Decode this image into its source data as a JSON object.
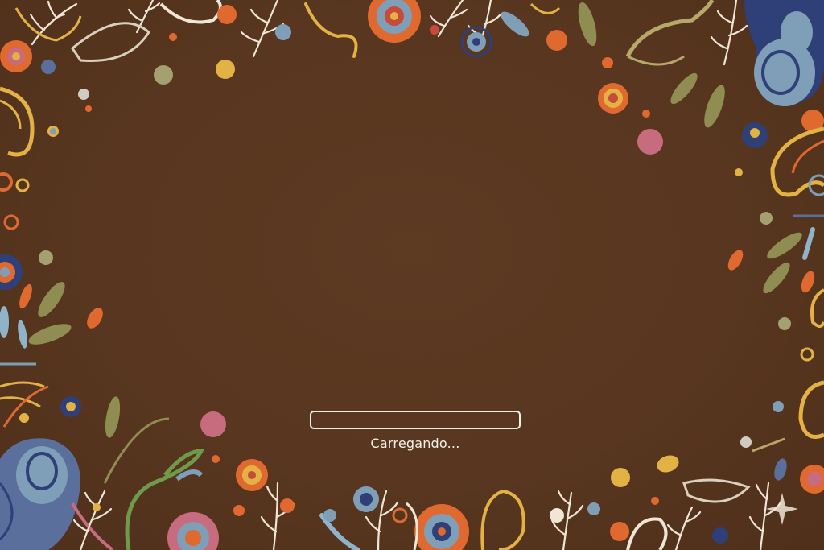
{
  "loading": {
    "label": "Carregando...",
    "progress_percent": 0
  },
  "colors": {
    "background": "#58361f",
    "loader_border": "#f4f1ec",
    "text": "#f6f2ea",
    "decor_orange": "#e0692f",
    "decor_yellow": "#e3b244",
    "decor_blue": "#7f9fb8",
    "decor_navy": "#2f3f78",
    "decor_olive": "#8f8d52",
    "decor_pink": "#c76b7e",
    "decor_cream": "#efe6d6"
  },
  "decoration": {
    "frame": "folk-art-floral-border"
  }
}
